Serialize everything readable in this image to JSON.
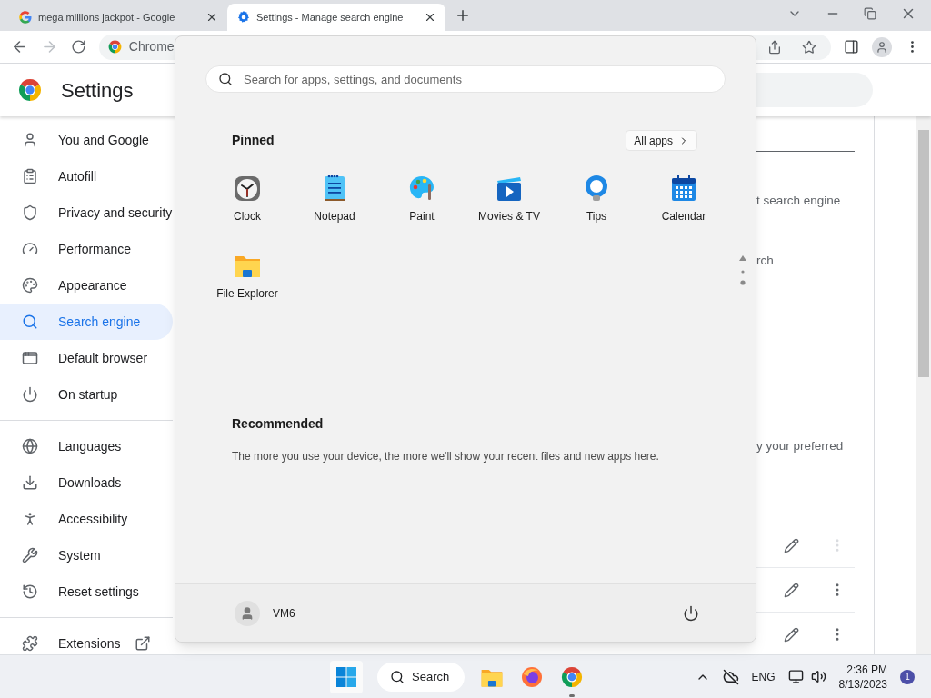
{
  "browser": {
    "tabs": [
      {
        "title": "mega millions jackpot - Google",
        "selected": false
      },
      {
        "title": "Settings - Manage search engine",
        "selected": true
      }
    ],
    "address": "Chrome"
  },
  "settings": {
    "title": "Settings",
    "sidebar": {
      "groups": [
        [
          {
            "label": "You and Google",
            "selected": false
          },
          {
            "label": "Autofill",
            "selected": false
          },
          {
            "label": "Privacy and security",
            "selected": false
          },
          {
            "label": "Performance",
            "selected": false
          },
          {
            "label": "Appearance",
            "selected": false
          },
          {
            "label": "Search engine",
            "selected": true
          },
          {
            "label": "Default browser",
            "selected": false
          },
          {
            "label": "On startup",
            "selected": false
          }
        ],
        [
          {
            "label": "Languages",
            "selected": false
          },
          {
            "label": "Downloads",
            "selected": false
          },
          {
            "label": "Accessibility",
            "selected": false
          },
          {
            "label": "System",
            "selected": false
          },
          {
            "label": "Reset settings",
            "selected": false
          }
        ],
        [
          {
            "label": "Extensions",
            "selected": false
          }
        ]
      ]
    },
    "content": {
      "texts": [
        "t search engine",
        "rch",
        "y your preferred"
      ],
      "rows": [
        {
          "disabled": true
        },
        {
          "disabled": false
        },
        {
          "disabled": false
        }
      ]
    }
  },
  "start_menu": {
    "search_placeholder": "Search for apps, settings, and documents",
    "pinned_title": "Pinned",
    "all_apps": "All apps",
    "apps": [
      "Clock",
      "Notepad",
      "Paint",
      "Movies & TV",
      "Tips",
      "Calendar",
      "File Explorer"
    ],
    "recommended_title": "Recommended",
    "recommended_text": "The more you use your device, the more we'll show your recent files and new apps here.",
    "user": "VM6"
  },
  "taskbar": {
    "search": "Search",
    "apps": [
      {
        "running": false
      },
      {
        "running": false
      },
      {
        "running": true
      }
    ],
    "language": "ENG",
    "time": "2:36 PM",
    "date": "8/13/2023",
    "notifications": "1"
  }
}
